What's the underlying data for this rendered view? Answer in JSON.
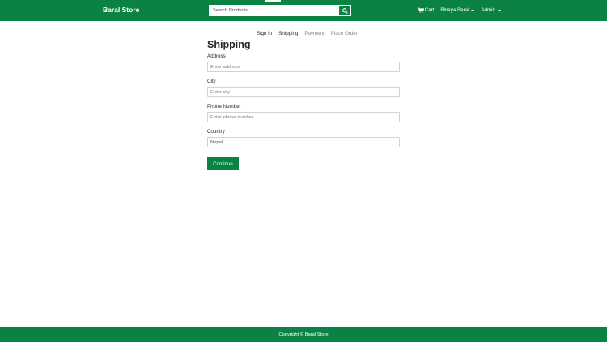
{
  "navbar": {
    "brand": "Baral Store",
    "search": {
      "placeholder": "Search Products...",
      "value": ""
    },
    "search_button_icon": "search-icon",
    "cart_label": "Cart",
    "cart_icon": "cart-icon",
    "user_menu_label": "Binaya Baral",
    "admin_menu_label": "Admin"
  },
  "steps": [
    {
      "label": "Sign In",
      "state": "active"
    },
    {
      "label": "Shipping",
      "state": "active"
    },
    {
      "label": "Payment",
      "state": "disabled"
    },
    {
      "label": "Place Order",
      "state": "disabled"
    }
  ],
  "form": {
    "title": "Shipping",
    "address": {
      "label": "Address",
      "placeholder": "Enter address",
      "value": ""
    },
    "city": {
      "label": "City",
      "placeholder": "Enter city",
      "value": ""
    },
    "phone": {
      "label": "Phone Number",
      "placeholder": "Enter phone number",
      "value": ""
    },
    "country": {
      "label": "Country",
      "placeholder": "",
      "value": "Nepal"
    },
    "submit_label": "Continue"
  },
  "footer": {
    "text": "Copyright © Baral Store"
  },
  "colors": {
    "brand": "#0a8244",
    "text": "#212529",
    "muted": "#888888"
  }
}
